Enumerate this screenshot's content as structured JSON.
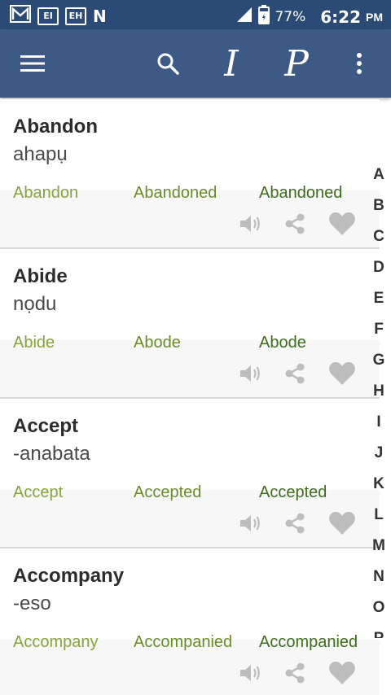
{
  "status_bar": {
    "notif_1": "EI",
    "notif_2": "EH",
    "notif_3": "N",
    "battery": "77%",
    "time": "6:22",
    "ampm": "PM"
  },
  "app_bar": {
    "italic_i": "I",
    "italic_p": "P"
  },
  "entries": [
    {
      "word": "Abandon",
      "translation": "ahapụ",
      "forms": [
        "Abandon",
        "Abandoned",
        "Abandoned"
      ]
    },
    {
      "word": "Abide",
      "translation": "nọdu",
      "forms": [
        "Abide",
        "Abode",
        "Abode"
      ]
    },
    {
      "word": "Accept",
      "translation": "-anabata",
      "forms": [
        "Accept",
        "Accepted",
        "Accepted"
      ]
    },
    {
      "word": "Accompany",
      "translation": "-eso",
      "forms": [
        "Accompany",
        "Accompanied",
        "Accompanied"
      ]
    }
  ],
  "alphabet": [
    "A",
    "B",
    "C",
    "D",
    "E",
    "F",
    "G",
    "H",
    "I",
    "J",
    "K",
    "L",
    "M",
    "N",
    "O",
    "P"
  ],
  "colors": {
    "status_bar": "#2b4a75",
    "app_bar": "#3c5a85",
    "form_light": "#8aa33a",
    "form_mid": "#6a8f28",
    "form_dark": "#3d6e1c",
    "action_icon": "#bdbdbd"
  },
  "icons": [
    "gmail-icon",
    "signal-icon",
    "battery-icon",
    "menu-icon",
    "search-icon",
    "more-vert-icon",
    "speaker-icon",
    "share-icon",
    "heart-icon"
  ]
}
